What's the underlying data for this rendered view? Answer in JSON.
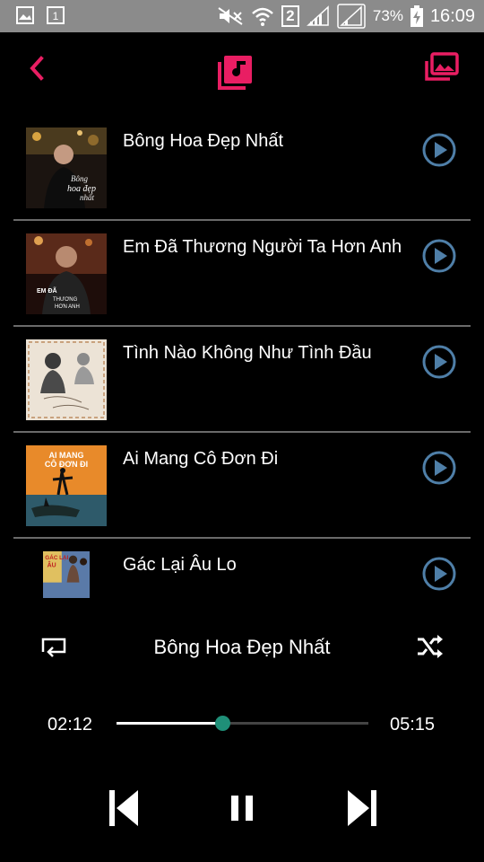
{
  "status_bar": {
    "sim_indicator": "2",
    "battery_percent": "73%",
    "time": "16:09"
  },
  "header": {
    "back_icon": "chevron-left-icon",
    "center_icon": "music-library-icon",
    "right_icon": "photo-gallery-icon",
    "accent_color": "#e91e63"
  },
  "songs": [
    {
      "title": "Bông Hoa Đẹp Nhất"
    },
    {
      "title": "Em Đã Thương Người Ta Hơn Anh"
    },
    {
      "title": "Tình Nào Không Như Tình Đầu"
    },
    {
      "title": "Ai Mang Cô Đơn Đi"
    },
    {
      "title": "Gác Lại Âu Lo"
    }
  ],
  "player": {
    "now_playing": "Bông Hoa Đẹp Nhất",
    "elapsed": "02:12",
    "duration": "05:15",
    "progress_fraction": 0.419,
    "play_button_color": "#4f7fa8",
    "knob_color": "#1f8f78"
  }
}
